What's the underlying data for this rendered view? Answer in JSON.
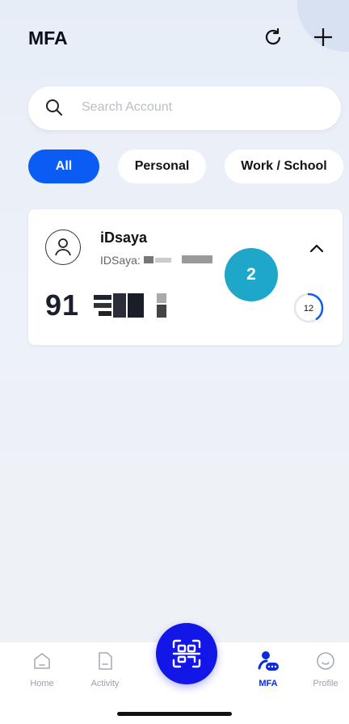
{
  "header": {
    "title": "MFA"
  },
  "search": {
    "placeholder": "Search Account"
  },
  "filters": [
    {
      "label": "All",
      "selected": true
    },
    {
      "label": "Personal",
      "selected": false
    },
    {
      "label": "Work / School",
      "selected": false
    }
  ],
  "account": {
    "name": "iDsaya",
    "username": "IDSaya:",
    "code_visible": "91",
    "timer_seconds": "12",
    "timer_progress": 0.4
  },
  "badge": {
    "number": "2"
  },
  "tabs": [
    {
      "label": "Home"
    },
    {
      "label": "Activity"
    },
    {
      "label": "MFA"
    },
    {
      "label": "Profile"
    }
  ],
  "colors": {
    "accent": "#0a5cf5",
    "scan": "#1217e8",
    "badge": "#1fa7c9"
  }
}
